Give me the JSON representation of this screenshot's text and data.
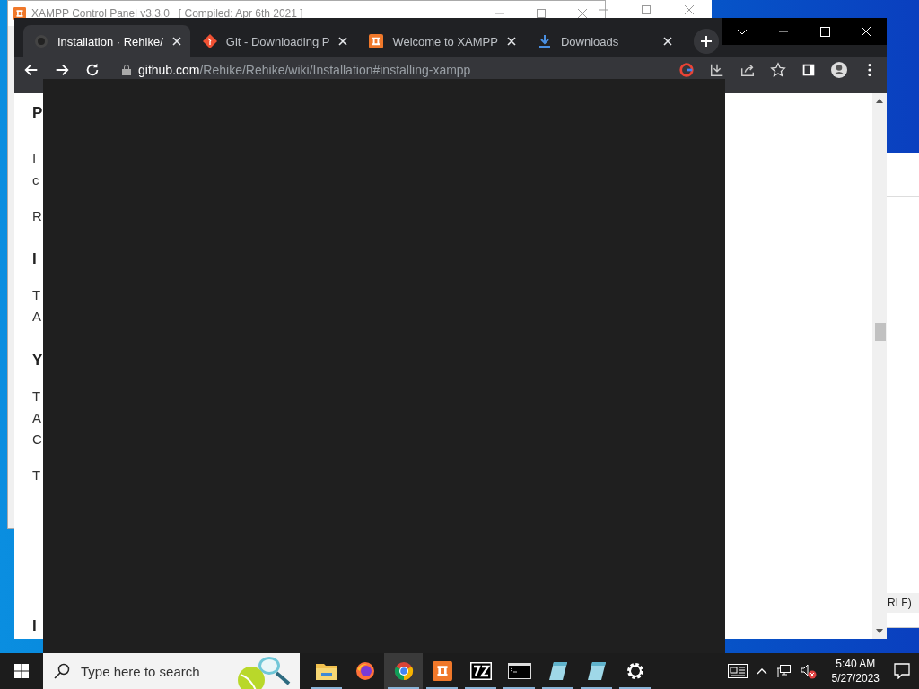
{
  "xampp_window": {
    "title": "XAMPP Control Panel v3.3.0   [ Compiled: Apr 6th 2021 ]"
  },
  "editor_window": {
    "status_text": "RLF)"
  },
  "browser": {
    "tabs": [
      {
        "title": "Installation · Rehike/",
        "selected": true
      },
      {
        "title": "Git - Downloading P",
        "selected": false
      },
      {
        "title": "Welcome to XAMPP",
        "selected": false
      },
      {
        "title": "Downloads",
        "selected": false
      }
    ],
    "address": {
      "host": "github.com",
      "path": "/Rehike/Rehike/wiki/Installation#installing-xampp"
    },
    "page_fragments": [
      {
        "text": "P",
        "kind": "heading"
      },
      {
        "text": "I",
        "kind": "text"
      },
      {
        "text": "c",
        "kind": "text"
      },
      {
        "text": "R",
        "kind": "text"
      },
      {
        "text": "I",
        "kind": "heading"
      },
      {
        "text": "T",
        "kind": "text"
      },
      {
        "text": "A",
        "kind": "text"
      },
      {
        "text": "Y",
        "kind": "heading"
      },
      {
        "text": "T",
        "kind": "text"
      },
      {
        "text": "A",
        "kind": "text"
      },
      {
        "text": "C",
        "kind": "text"
      },
      {
        "text": "T",
        "kind": "text"
      },
      {
        "text": "I",
        "kind": "heading"
      }
    ]
  },
  "taskbar": {
    "search": {
      "placeholder": "Type here to search"
    },
    "apps": [
      {
        "kind": "explorer",
        "running": true,
        "selected": false
      },
      {
        "kind": "firefox",
        "running": false,
        "selected": false
      },
      {
        "kind": "chrome",
        "running": true,
        "selected": true
      },
      {
        "kind": "xampp",
        "running": true,
        "selected": false
      },
      {
        "kind": "sevenzip",
        "running": true,
        "selected": false
      },
      {
        "kind": "terminal",
        "running": true,
        "selected": false
      },
      {
        "kind": "notepad",
        "running": true,
        "selected": false
      },
      {
        "kind": "notepad",
        "running": true,
        "selected": false
      },
      {
        "kind": "settings",
        "running": true,
        "selected": false
      }
    ],
    "clock": {
      "time": "5:40 AM",
      "date": "5/27/2023"
    }
  }
}
